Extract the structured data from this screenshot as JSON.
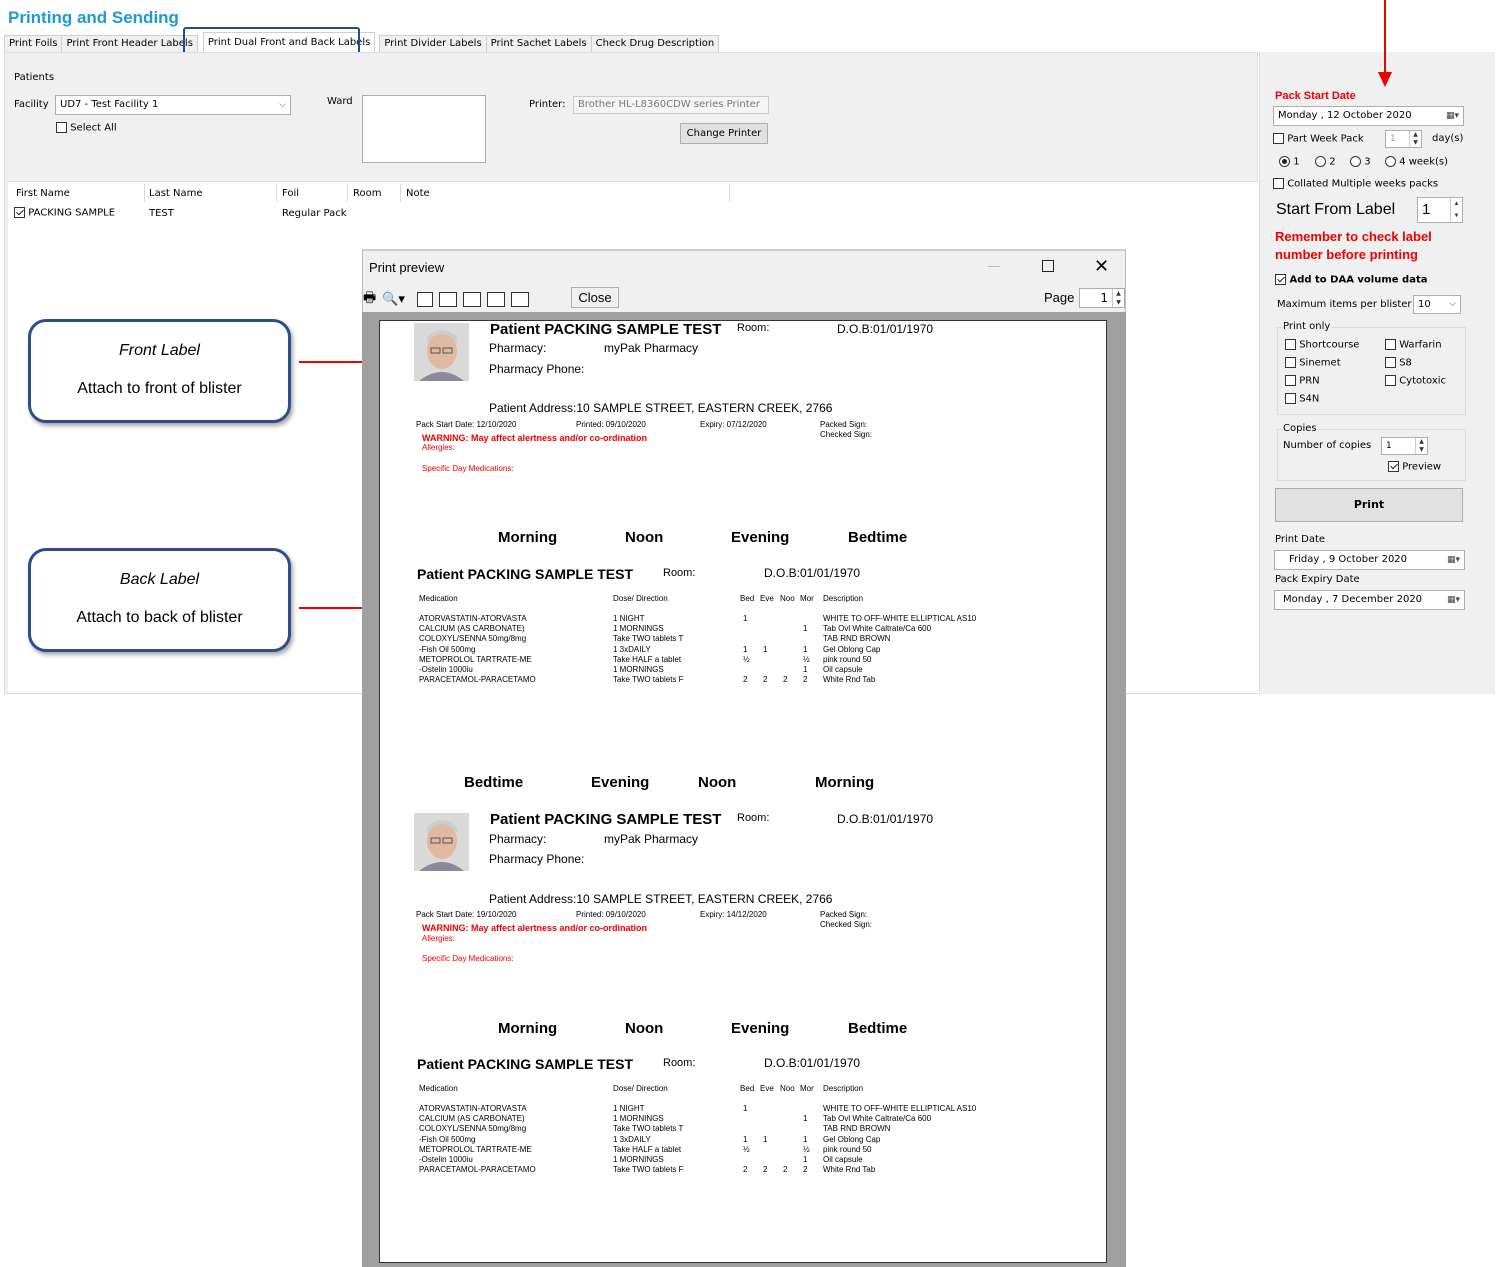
{
  "app": {
    "title": "Printing and Sending"
  },
  "tabs": [
    "Print Foils",
    "Print Front Header Labels",
    "Print Dual Front and Back Labels",
    "Print Divider Labels",
    "Print Sachet Labels",
    "Check Drug Description"
  ],
  "patients_panel": {
    "group_label": "Patients",
    "facility_label": "Facility",
    "facility_value": "UD7 - Test Facility 1",
    "select_all": "Select All",
    "ward_label": "Ward",
    "printer_label": "Printer:",
    "printer_value": "Brother HL-L8360CDW series Printer",
    "change_printer": "Change Printer"
  },
  "grid": {
    "columns": [
      "First Name",
      "Last Name",
      "Foil",
      "Room",
      "Note"
    ],
    "rows": [
      {
        "first": "PACKING SAMPLE",
        "last": "TEST",
        "foil": "Regular Pack",
        "room": "",
        "note": ""
      }
    ]
  },
  "callouts": {
    "front": {
      "title": "Front Label",
      "text": "Attach to front of blister"
    },
    "back": {
      "title": "Back Label",
      "text": "Attach to back of blister"
    }
  },
  "right_panel": {
    "pack_start_label": "Pack Start Date",
    "pack_start_value": "Monday   , 12   October   2020",
    "part_week": "Part Week Pack",
    "part_week_val": "1",
    "days": "day(s)",
    "radios": [
      "1",
      "2",
      "3",
      "4 week(s)"
    ],
    "collated": "Collated Multiple weeks packs",
    "start_from_label": "Start From Label",
    "start_from_value": "1",
    "remember": "Remember to check label number before printing",
    "add_daa": "Add to DAA volume data",
    "max_items_label": "Maximum items per blister",
    "max_items_value": "10",
    "print_only": "Print only",
    "print_only_items": [
      "Shortcourse",
      "Warfarin",
      "Sinemet",
      "S8",
      "PRN",
      "Cytotoxic",
      "S4N"
    ],
    "copies_group": "Copies",
    "copies_label": "Number of copies",
    "copies_value": "1",
    "preview": "Preview",
    "print_button": "Print",
    "print_date_label": "Print Date",
    "print_date_value": "Friday   ,   9   October   2020",
    "expiry_label": "Pack Expiry Date",
    "expiry_value": "Monday   ,   7 December  2020"
  },
  "print_preview": {
    "title": "Print preview",
    "close": "Close",
    "page_label": "Page",
    "page_value": "1"
  },
  "label": {
    "patient_prefix": "Patient",
    "patient_name": "PACKING SAMPLE TEST",
    "room": "Room:",
    "dob": "D.O.B:01/01/1970",
    "pharmacy_label": "Pharmacy:",
    "pharmacy_value": "myPak Pharmacy",
    "pharmacy_phone": "Pharmacy Phone:",
    "address": "Patient Address:10 SAMPLE STREET, EASTERN CREEK, 2766",
    "pack_start_1": "Pack Start Date: 12/10/2020",
    "pack_start_2": "Pack Start Date: 19/10/2020",
    "printed": "Printed: 09/10/2020",
    "expiry_1": "Expiry: 07/12/2020",
    "expiry_2": "Expiry: 14/12/2020",
    "packed_sign": "Packed Sign:",
    "checked_sign": "Checked Sign:",
    "warning": "WARNING: May affect alertness and/or co-ordination",
    "allergies": "Allergies:",
    "specific_day": "Specific Day Medications:",
    "front_headings": [
      "Morning",
      "Noon",
      "Evening",
      "Bedtime"
    ],
    "back_headings": [
      "Bedtime",
      "Evening",
      "Noon",
      "Morning"
    ],
    "med_cols": [
      "Medication",
      "Dose/ Direction",
      "Bed",
      "Eve",
      "Noo",
      "Mor",
      "Description"
    ],
    "meds": [
      {
        "m": "ATORVASTATIN-ATORVASTA",
        "d": "1 NIGHT",
        "bed": "1",
        "eve": "",
        "noo": "",
        "mor": "",
        "desc": "WHITE TO OFF-WHITE ELLIPTICAL AS10"
      },
      {
        "m": "CALCIUM (AS CARBONATE)",
        "d": "1 MORNINGS",
        "bed": "",
        "eve": "",
        "noo": "",
        "mor": "1",
        "desc": "Tab Ovl White Caltrate/Ca 600"
      },
      {
        "m": "COLOXYL/SENNA 50mg/8mg",
        "d": "Take TWO tablets T",
        "bed": "",
        "eve": "",
        "noo": "",
        "mor": "",
        "desc": "TAB RND BROWN"
      },
      {
        "m": "-Fish Oil 500mg",
        "d": "1 3xDAILY",
        "bed": "1",
        "eve": "1",
        "noo": "",
        "mor": "1",
        "desc": "Gel Oblong Cap"
      },
      {
        "m": "METOPROLOL TARTRATE-ME",
        "d": "Take HALF a tablet",
        "bed": "½",
        "eve": "",
        "noo": "",
        "mor": "½",
        "desc": "pink round 50"
      },
      {
        "m": "-Ostelin 1000iu",
        "d": "1 MORNINGS",
        "bed": "",
        "eve": "",
        "noo": "",
        "mor": "1",
        "desc": "Oil capsule"
      },
      {
        "m": "PARACETAMOL-PARACETAMO",
        "d": "Take TWO tablets F",
        "bed": "2",
        "eve": "2",
        "noo": "2",
        "mor": "2",
        "desc": "White Rnd Tab"
      }
    ]
  }
}
